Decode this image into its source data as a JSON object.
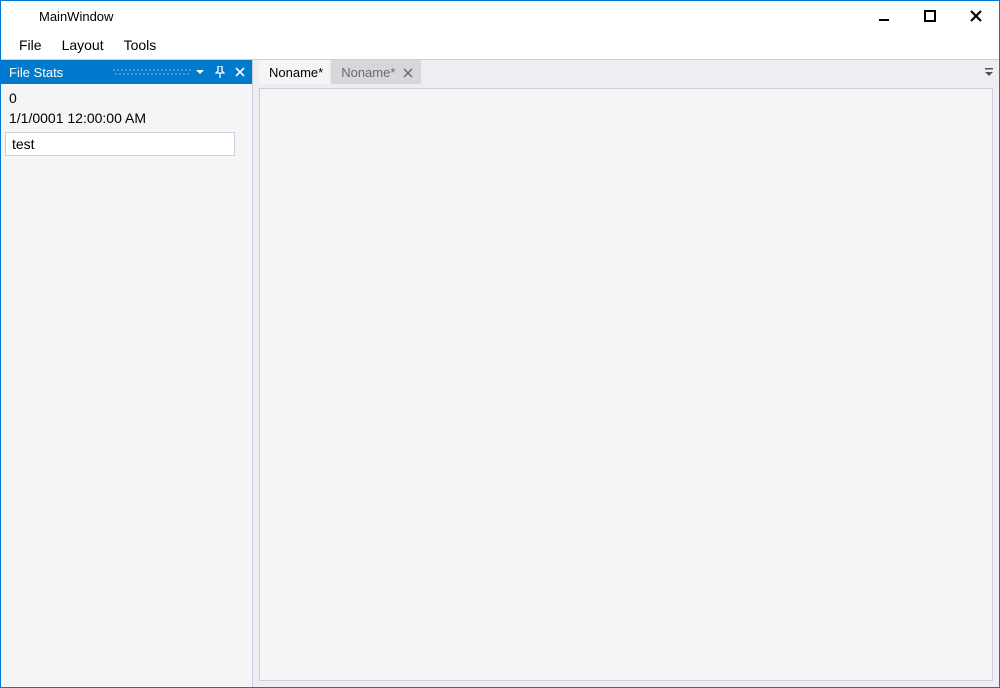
{
  "window": {
    "title": "MainWindow"
  },
  "menu": {
    "items": [
      "File",
      "Layout",
      "Tools"
    ]
  },
  "sidepanel": {
    "title": "File Stats",
    "line1": "0",
    "line2": "1/1/0001 12:00:00 AM",
    "input_value": "test"
  },
  "tabs": [
    {
      "label": "Noname*",
      "active": true
    },
    {
      "label": "Noname*",
      "active": false
    }
  ]
}
